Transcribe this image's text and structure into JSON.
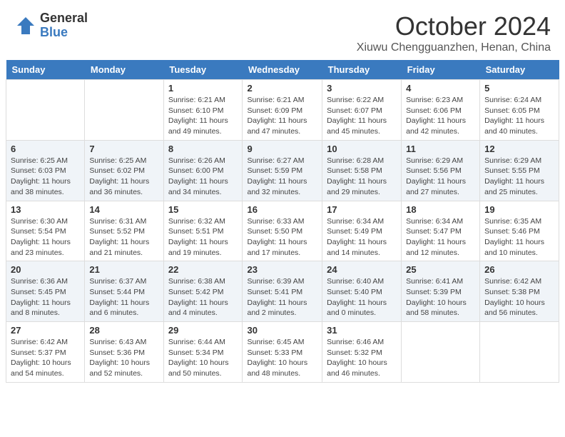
{
  "logo": {
    "general": "General",
    "blue": "Blue"
  },
  "header": {
    "month": "October 2024",
    "location": "Xiuwu Chengguanzhen, Henan, China"
  },
  "weekdays": [
    "Sunday",
    "Monday",
    "Tuesday",
    "Wednesday",
    "Thursday",
    "Friday",
    "Saturday"
  ],
  "weeks": [
    [
      {
        "date": "",
        "sunrise": "",
        "sunset": "",
        "daylight": ""
      },
      {
        "date": "",
        "sunrise": "",
        "sunset": "",
        "daylight": ""
      },
      {
        "date": "1",
        "sunrise": "Sunrise: 6:21 AM",
        "sunset": "Sunset: 6:10 PM",
        "daylight": "Daylight: 11 hours and 49 minutes."
      },
      {
        "date": "2",
        "sunrise": "Sunrise: 6:21 AM",
        "sunset": "Sunset: 6:09 PM",
        "daylight": "Daylight: 11 hours and 47 minutes."
      },
      {
        "date": "3",
        "sunrise": "Sunrise: 6:22 AM",
        "sunset": "Sunset: 6:07 PM",
        "daylight": "Daylight: 11 hours and 45 minutes."
      },
      {
        "date": "4",
        "sunrise": "Sunrise: 6:23 AM",
        "sunset": "Sunset: 6:06 PM",
        "daylight": "Daylight: 11 hours and 42 minutes."
      },
      {
        "date": "5",
        "sunrise": "Sunrise: 6:24 AM",
        "sunset": "Sunset: 6:05 PM",
        "daylight": "Daylight: 11 hours and 40 minutes."
      }
    ],
    [
      {
        "date": "6",
        "sunrise": "Sunrise: 6:25 AM",
        "sunset": "Sunset: 6:03 PM",
        "daylight": "Daylight: 11 hours and 38 minutes."
      },
      {
        "date": "7",
        "sunrise": "Sunrise: 6:25 AM",
        "sunset": "Sunset: 6:02 PM",
        "daylight": "Daylight: 11 hours and 36 minutes."
      },
      {
        "date": "8",
        "sunrise": "Sunrise: 6:26 AM",
        "sunset": "Sunset: 6:00 PM",
        "daylight": "Daylight: 11 hours and 34 minutes."
      },
      {
        "date": "9",
        "sunrise": "Sunrise: 6:27 AM",
        "sunset": "Sunset: 5:59 PM",
        "daylight": "Daylight: 11 hours and 32 minutes."
      },
      {
        "date": "10",
        "sunrise": "Sunrise: 6:28 AM",
        "sunset": "Sunset: 5:58 PM",
        "daylight": "Daylight: 11 hours and 29 minutes."
      },
      {
        "date": "11",
        "sunrise": "Sunrise: 6:29 AM",
        "sunset": "Sunset: 5:56 PM",
        "daylight": "Daylight: 11 hours and 27 minutes."
      },
      {
        "date": "12",
        "sunrise": "Sunrise: 6:29 AM",
        "sunset": "Sunset: 5:55 PM",
        "daylight": "Daylight: 11 hours and 25 minutes."
      }
    ],
    [
      {
        "date": "13",
        "sunrise": "Sunrise: 6:30 AM",
        "sunset": "Sunset: 5:54 PM",
        "daylight": "Daylight: 11 hours and 23 minutes."
      },
      {
        "date": "14",
        "sunrise": "Sunrise: 6:31 AM",
        "sunset": "Sunset: 5:52 PM",
        "daylight": "Daylight: 11 hours and 21 minutes."
      },
      {
        "date": "15",
        "sunrise": "Sunrise: 6:32 AM",
        "sunset": "Sunset: 5:51 PM",
        "daylight": "Daylight: 11 hours and 19 minutes."
      },
      {
        "date": "16",
        "sunrise": "Sunrise: 6:33 AM",
        "sunset": "Sunset: 5:50 PM",
        "daylight": "Daylight: 11 hours and 17 minutes."
      },
      {
        "date": "17",
        "sunrise": "Sunrise: 6:34 AM",
        "sunset": "Sunset: 5:49 PM",
        "daylight": "Daylight: 11 hours and 14 minutes."
      },
      {
        "date": "18",
        "sunrise": "Sunrise: 6:34 AM",
        "sunset": "Sunset: 5:47 PM",
        "daylight": "Daylight: 11 hours and 12 minutes."
      },
      {
        "date": "19",
        "sunrise": "Sunrise: 6:35 AM",
        "sunset": "Sunset: 5:46 PM",
        "daylight": "Daylight: 11 hours and 10 minutes."
      }
    ],
    [
      {
        "date": "20",
        "sunrise": "Sunrise: 6:36 AM",
        "sunset": "Sunset: 5:45 PM",
        "daylight": "Daylight: 11 hours and 8 minutes."
      },
      {
        "date": "21",
        "sunrise": "Sunrise: 6:37 AM",
        "sunset": "Sunset: 5:44 PM",
        "daylight": "Daylight: 11 hours and 6 minutes."
      },
      {
        "date": "22",
        "sunrise": "Sunrise: 6:38 AM",
        "sunset": "Sunset: 5:42 PM",
        "daylight": "Daylight: 11 hours and 4 minutes."
      },
      {
        "date": "23",
        "sunrise": "Sunrise: 6:39 AM",
        "sunset": "Sunset: 5:41 PM",
        "daylight": "Daylight: 11 hours and 2 minutes."
      },
      {
        "date": "24",
        "sunrise": "Sunrise: 6:40 AM",
        "sunset": "Sunset: 5:40 PM",
        "daylight": "Daylight: 11 hours and 0 minutes."
      },
      {
        "date": "25",
        "sunrise": "Sunrise: 6:41 AM",
        "sunset": "Sunset: 5:39 PM",
        "daylight": "Daylight: 10 hours and 58 minutes."
      },
      {
        "date": "26",
        "sunrise": "Sunrise: 6:42 AM",
        "sunset": "Sunset: 5:38 PM",
        "daylight": "Daylight: 10 hours and 56 minutes."
      }
    ],
    [
      {
        "date": "27",
        "sunrise": "Sunrise: 6:42 AM",
        "sunset": "Sunset: 5:37 PM",
        "daylight": "Daylight: 10 hours and 54 minutes."
      },
      {
        "date": "28",
        "sunrise": "Sunrise: 6:43 AM",
        "sunset": "Sunset: 5:36 PM",
        "daylight": "Daylight: 10 hours and 52 minutes."
      },
      {
        "date": "29",
        "sunrise": "Sunrise: 6:44 AM",
        "sunset": "Sunset: 5:34 PM",
        "daylight": "Daylight: 10 hours and 50 minutes."
      },
      {
        "date": "30",
        "sunrise": "Sunrise: 6:45 AM",
        "sunset": "Sunset: 5:33 PM",
        "daylight": "Daylight: 10 hours and 48 minutes."
      },
      {
        "date": "31",
        "sunrise": "Sunrise: 6:46 AM",
        "sunset": "Sunset: 5:32 PM",
        "daylight": "Daylight: 10 hours and 46 minutes."
      },
      {
        "date": "",
        "sunrise": "",
        "sunset": "",
        "daylight": ""
      },
      {
        "date": "",
        "sunrise": "",
        "sunset": "",
        "daylight": ""
      }
    ]
  ]
}
